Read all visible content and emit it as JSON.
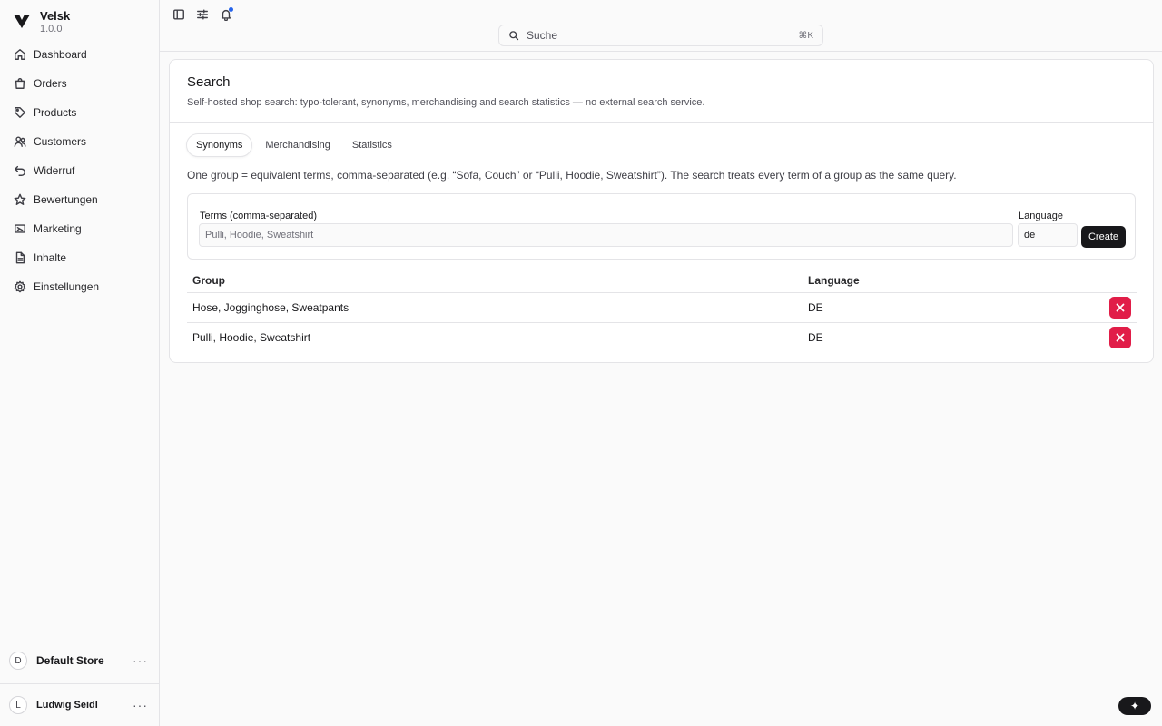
{
  "brand": {
    "name": "Velsk",
    "version": "1.0.0"
  },
  "sidebar": {
    "items": [
      {
        "label": "Dashboard",
        "icon": "home-icon"
      },
      {
        "label": "Orders",
        "icon": "shopping-bag-icon"
      },
      {
        "label": "Products",
        "icon": "tag-icon"
      },
      {
        "label": "Customers",
        "icon": "users-icon"
      },
      {
        "label": "Widerruf",
        "icon": "undo-icon"
      },
      {
        "label": "Bewertungen",
        "icon": "star-icon"
      },
      {
        "label": "Marketing",
        "icon": "ticket-icon"
      },
      {
        "label": "Inhalte",
        "icon": "file-icon"
      },
      {
        "label": "Einstellungen",
        "icon": "gear-icon"
      }
    ],
    "store": {
      "initial": "D",
      "name": "Default Store"
    },
    "user": {
      "initial": "L",
      "name": "Ludwig Seidl"
    },
    "more_label": "···"
  },
  "topbar": {
    "search_label": "Suche",
    "search_shortcut": "⌘K",
    "icons": [
      "sidebar-toggle-icon",
      "sliders-icon",
      "bell-icon"
    ],
    "notification_dot_color": "#2563eb"
  },
  "page": {
    "title": "Search",
    "description": "Self-hosted shop search: typo-tolerant, synonyms, merchandising and search statistics — no external search service.",
    "tabs": [
      {
        "label": "Synonyms",
        "active": true
      },
      {
        "label": "Merchandising",
        "active": false
      },
      {
        "label": "Statistics",
        "active": false
      }
    ],
    "help_text": "One group = equivalent terms, comma-separated (e.g. “Sofa, Couch” or “Pulli, Hoodie, Sweatshirt”). The search treats every term of a group as the same query."
  },
  "form": {
    "terms_label": "Terms (comma-separated)",
    "terms_placeholder": "Pulli, Hoodie, Sweatshirt",
    "terms_value": "",
    "language_label": "Language",
    "language_value": "de",
    "create_label": "Create"
  },
  "table": {
    "headers": {
      "group": "Group",
      "language": "Language"
    },
    "rows": [
      {
        "group": "Hose, Jogginghose, Sweatpants",
        "language": "DE"
      },
      {
        "group": "Pulli, Hoodie, Sweatshirt",
        "language": "DE"
      }
    ],
    "delete_color": "#e11d48"
  },
  "fab": {
    "label": "✦"
  }
}
